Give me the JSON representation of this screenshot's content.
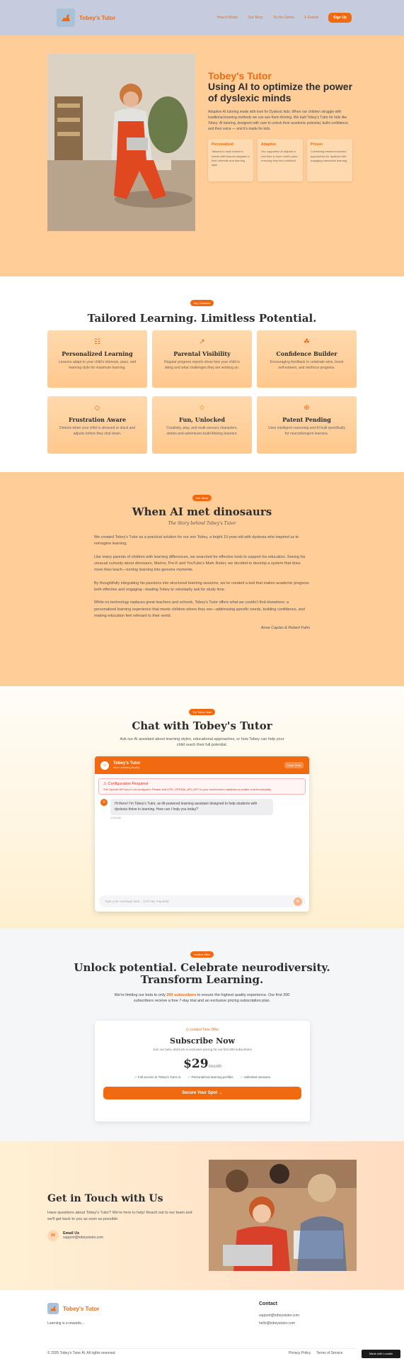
{
  "nav": {
    "brand": "Tobey's Tutor",
    "links": [
      "How it Works",
      "Our Story",
      "Try the Demo",
      "Events"
    ],
    "signup": "Sign Up"
  },
  "hero": {
    "title": "Tobey's Tutor",
    "subtitle": "Using AI to optimize the power of dyslexic minds",
    "description": "Adaptive AI tutoring made with love for Dyslexic kids. When our children struggle with traditional learning methods we can see them thriving. We built Tobey's Tutor for kids like Tobey: AI tutoring, designed with care to unlock their academic potential, build confidence, and their voice — and it's made for kids.",
    "cards": [
      {
        "title": "Personalized",
        "desc": "Tailored to each learner's needs with lessons adapted to their interests and learning style."
      },
      {
        "title": "Adaptive",
        "desc": "Our supportive AI adjusts in real time to each child's pace, ensuring they feel confident."
      },
      {
        "title": "Proven",
        "desc": "Combining research-backed approaches for dyslexia with engaging interactive learning."
      }
    ]
  },
  "features": {
    "pill": "Key Features",
    "title": "Tailored Learning. Limitless Potential.",
    "items": [
      {
        "icon": "book-icon",
        "glyph": "☷",
        "title": "Personalized Learning",
        "desc": "Lessons adapt to your child's interests, pace, and learning style for maximum learning."
      },
      {
        "icon": "chart-icon",
        "glyph": "↗",
        "title": "Parental Visibility",
        "desc": "Regular progress reports show how your child is doing and what challenges they are working on."
      },
      {
        "icon": "award-icon",
        "glyph": "☘",
        "title": "Confidence Builder",
        "desc": "Encouraging feedback to celebrate wins, boost self-esteem, and reinforce progress."
      },
      {
        "icon": "shield-icon",
        "glyph": "◇",
        "title": "Frustration Aware",
        "desc": "Detects when your child is stressed or stuck and adjusts before they shut down."
      },
      {
        "icon": "lightbulb-icon",
        "glyph": "☆",
        "title": "Fun, Unlocked",
        "desc": "Creativity, play, and multi-sensory characters, stories and adventures build lifelong learners."
      },
      {
        "icon": "globe-icon",
        "glyph": "⊕",
        "title": "Patent Pending",
        "desc": "Uses intelligent reasoning and AI built specifically for neurodivergent learners."
      }
    ]
  },
  "story": {
    "pill": "Our Story",
    "title": "When AI met dinosaurs",
    "subtitle": "The Story behind Tobey's Tutor",
    "paragraphs": [
      "We created Tobey's Tutor as a practical solution for our son Tobey, a bright 10-year-old with dyslexia who inspired us to reimagine learning.",
      "Like many parents of children with learning differences, we searched for effective tools to support his education. Seeing his unusual curiosity about dinosaurs, Marine, Pre-K and YouTube's Mark Rober, we decided to develop a system that does more than teach—turning learning into genuine moments.",
      "By thoughtfully integrating his passions into structured learning sessions, we've created a tool that makes academic progress both effective and engaging—leading Tobey to voluntarily ask for study time.",
      "While no technology replaces great teachers and schools, Tobey's Tutor offers what we couldn't find elsewhere: a personalized learning experience that meets children where they are—addressing specific needs, building confidence, and making education feel relevant to their world."
    ],
    "signature": "Anne Caplan & Robert Fahn"
  },
  "chat": {
    "pill": "Try Tobey Now",
    "title": "Chat with Tobey's Tutor",
    "desc": "Ask our AI assistant about learning styles, educational approaches, or how Tobey can help your child reach their full potential.",
    "head_title": "Tobey's Tutor",
    "head_sub": "Your Learning Buddy",
    "clear": "Clear Chat",
    "error_title": "Configuration Required",
    "error_msg": "The OpenAI API key is not configured. Please add VITE_OPENAI_API_KEY to your environment variables to enable chat functionality.",
    "bot_message": "Hi there! I'm Tobey's Tutor, an AI-powered learning assistant designed to help students with dyslexia thrive in learning. How can I help you today?",
    "time": "10:00 AM",
    "placeholder": "Type your message here... (API key required)"
  },
  "pricing": {
    "pill": "Limited Offer",
    "title": "Unlock potential. Celebrate neurodiversity. Transform Learning.",
    "desc_pre": "We're limiting our beta to only ",
    "desc_highlight": "200 subscribers",
    "desc_post": " to ensure the highest quality experience. Our first 200 subscribers receive a free 7-day trial and an exclusive pricing subscription plan.",
    "badge": "Limited Time Offer",
    "plan_title": "Subscribe Now",
    "plan_desc": "Join our beta, and lock in exclusive pricing for our first 200 subscribers",
    "price": "$29",
    "per": "/month",
    "perks": [
      "Full access to Tobey's Tutor AI",
      "Personalized learning profiles",
      "Unlimited sessions"
    ],
    "cta": "Secure Your Spot →"
  },
  "contact": {
    "title": "Get in Touch with Us",
    "desc": "Have questions about Tobey's Tutor? We're here to help! Reach out to our team and we'll get back to you as soon as possible.",
    "email_label": "Email Us",
    "email": "support@tobeystutor.com"
  },
  "footer": {
    "brand": "Tobey's Tutor",
    "tagline": "Learning is a rewards...",
    "contact_title": "Contact",
    "contact_items": [
      "support@tobeystutor.com",
      "hello@tobeystutor.com"
    ],
    "copyright": "© 2025 Tobey's Tutor AI. All rights reserved.",
    "privacy": "Privacy Policy",
    "terms": "Terms of Service",
    "made_with": "Made with Lovable"
  },
  "colors": {
    "accent": "#f26a10",
    "hero_bg": "#ffcd98",
    "nav_bg": "#c5ccdd"
  }
}
